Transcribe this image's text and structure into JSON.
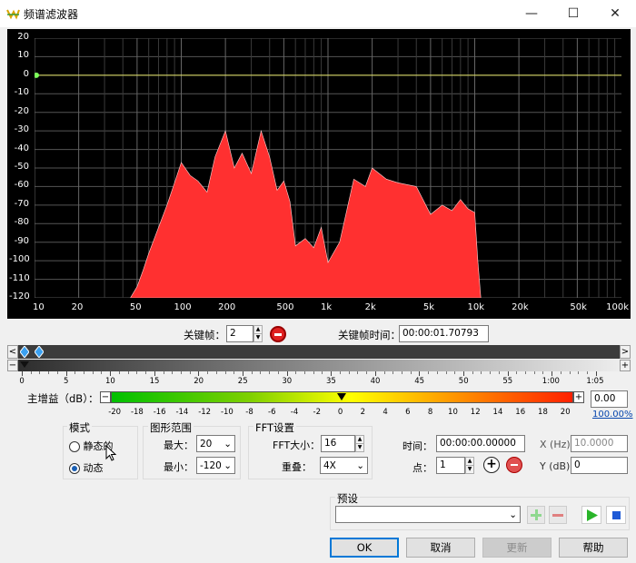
{
  "window": {
    "title": "频谱滤波器",
    "minimize": "—",
    "maximize": "☐",
    "close": "✕"
  },
  "spectrum": {
    "y_ticks": [
      "20",
      "10",
      "0",
      "-10",
      "-20",
      "-30",
      "-40",
      "-50",
      "-60",
      "-70",
      "-80",
      "-90",
      "-100",
      "-110",
      "-120"
    ],
    "x_ticks": [
      "10",
      "20",
      "50",
      "100",
      "200",
      "500",
      "1k",
      "2k",
      "5k",
      "10k",
      "20k",
      "50k",
      "100k"
    ],
    "chart_data": {
      "type": "area",
      "xscale": "log",
      "xlim": [
        10,
        100000
      ],
      "ylim": [
        -120,
        20
      ],
      "x_ticks": [
        "10",
        "20",
        "50",
        "100",
        "200",
        "500",
        "1k",
        "2k",
        "5k",
        "10k",
        "20k",
        "50k",
        "100k"
      ],
      "y_ticks": [
        20,
        10,
        0,
        -10,
        -20,
        -30,
        -40,
        -50,
        -60,
        -70,
        -80,
        -90,
        -100,
        -110,
        -120
      ],
      "filter_curve": {
        "x": [
          10,
          100000
        ],
        "y": [
          0,
          0
        ]
      },
      "spectrum": {
        "x": [
          45,
          50,
          55,
          60,
          70,
          80,
          90,
          100,
          115,
          130,
          150,
          170,
          200,
          230,
          260,
          300,
          350,
          400,
          450,
          500,
          550,
          600,
          700,
          800,
          900,
          1000,
          1200,
          1500,
          1800,
          2000,
          2500,
          3000,
          4000,
          5000,
          6000,
          7000,
          8000,
          9000,
          10000,
          10500,
          11000
        ],
        "y": [
          -120,
          -114,
          -105,
          -96,
          -82,
          -70,
          -58,
          -47,
          -54,
          -57,
          -63,
          -44,
          -30,
          -50,
          -42,
          -53,
          -30,
          -44,
          -62,
          -57,
          -68,
          -92,
          -88,
          -93,
          -82,
          -101,
          -90,
          -56,
          -60,
          -50,
          -56,
          -58,
          -60,
          -75,
          -70,
          -73,
          -67,
          -72,
          -74,
          -100,
          -120
        ]
      }
    }
  },
  "keyframe": {
    "label": "关键帧：",
    "value": "2",
    "time_label": "关键帧时间：",
    "time_value": "00:00:01.70793"
  },
  "timeline": {
    "ticks": [
      "0",
      "5",
      "10",
      "15",
      "20",
      "25",
      "30",
      "35",
      "40",
      "45",
      "50",
      "55",
      "1:00",
      "1:05"
    ],
    "left_arrow": "<",
    "right_arrow": ">",
    "minus": "−",
    "plus": "+"
  },
  "gain": {
    "label": "主增益（dB）：",
    "ticks": [
      "-20",
      "-18",
      "-16",
      "-14",
      "-12",
      "-10",
      "-8",
      "-6",
      "-4",
      "-2",
      "0",
      "2",
      "4",
      "6",
      "8",
      "10",
      "12",
      "14",
      "16",
      "18",
      "20"
    ],
    "value": "0.00",
    "percent": "100.00%",
    "minus": "−",
    "plus": "+"
  },
  "mode": {
    "title": "模式",
    "static_label": "静态的",
    "dynamic_label": "动态"
  },
  "range": {
    "title": "图形范围",
    "max_label": "最大：",
    "max_value": "20",
    "min_label": "最小：",
    "min_value": "-120"
  },
  "fft": {
    "title": "FFT设置",
    "size_label": "FFT大小：",
    "size_value": "16",
    "overlap_label": "重叠：",
    "overlap_value": "4X"
  },
  "point": {
    "time_label": "时间：",
    "time_value": "00:00:00.00000",
    "xhz_label": "X (Hz):",
    "xhz_value": "10.0000",
    "point_label": "点：",
    "point_value": "1",
    "ydb_label": "Y (dB):",
    "ydb_value": "0"
  },
  "preset": {
    "title": "预设",
    "value": ""
  },
  "buttons": {
    "ok": "OK",
    "cancel": "取消",
    "update": "更新",
    "help": "帮助"
  }
}
